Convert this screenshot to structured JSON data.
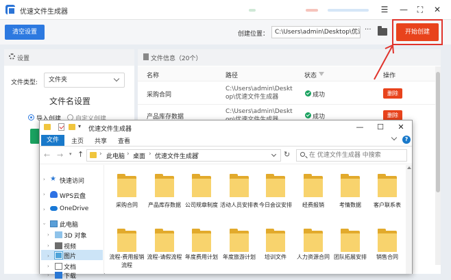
{
  "app": {
    "title": "优速文件生成器",
    "toolbar": {
      "empty_settings": "清空设置",
      "create_location_label": "创建位置：",
      "create_location_value": "C:\\Users\\admin\\Desktop\\优速",
      "more": "···",
      "start_create": "开始创建"
    },
    "window_controls": {
      "menu": "☰",
      "minimize": "—",
      "maximize": "⛶",
      "close": "✕"
    },
    "settings_panel": {
      "header": "设置",
      "file_type_label": "文件类型:",
      "file_type_value": "文件夹",
      "filename_settings_title": "文件名设置",
      "radio_import": "导入创建",
      "radio_custom": "自定义创建"
    },
    "file_info_panel": {
      "header": "文件信息（20个）",
      "columns": {
        "name": "名称",
        "path": "路径",
        "status": "状态",
        "action": "操作"
      },
      "rows": [
        {
          "name": "采购合同",
          "path_line1": "C:\\Users\\admin\\Deskt",
          "path_line2": "op\\优速文件生成器",
          "status": "成功",
          "action": "删除"
        },
        {
          "name": "产品库存数据",
          "path_line1": "C:\\Users\\admin\\Deskt",
          "path_line2": "op\\优速文件生成器",
          "status": "成功",
          "action": "删除"
        }
      ]
    },
    "accent_colors": {
      "primary": "#2d79e0",
      "danger": "#e8431c",
      "success": "#1aa260"
    }
  },
  "explorer": {
    "title": "优速文件生成器",
    "controls": {
      "minimize": "—",
      "maximize": "☐",
      "close": "✕"
    },
    "ribbon_tabs": [
      "文件",
      "主页",
      "共享",
      "查看"
    ],
    "help": "?",
    "address_crumbs": [
      "此电脑",
      "桌面",
      "优速文件生成器"
    ],
    "search_placeholder": "在 优速文件生成器 中搜索",
    "sidebar": [
      {
        "label": "快速访问",
        "icon": "star-icon"
      },
      {
        "label": "WPS云盘",
        "icon": "cloud-icon"
      },
      {
        "label": "OneDrive",
        "icon": "onedrive-icon"
      },
      {
        "label": "此电脑",
        "icon": "computer-icon"
      },
      {
        "label": "3D 对象",
        "icon": "cube-icon"
      },
      {
        "label": "视频",
        "icon": "video-icon"
      },
      {
        "label": "图片",
        "icon": "picture-icon"
      },
      {
        "label": "文档",
        "icon": "document-icon"
      },
      {
        "label": "下载",
        "icon": "download-icon"
      }
    ],
    "folders_row1": [
      "采购合同",
      "产品库存数据",
      "公司规章制度",
      "活动人员安排表",
      "今日会议安排",
      "经费报销",
      "考情数据",
      "客户联系表"
    ],
    "folders_row2": [
      "流程-费用报销流程",
      "流程-请假流程",
      "年度费用计划",
      "年度旅游计划",
      "培训文件",
      "人力资源合同",
      "团队拓展安排",
      "销售合同"
    ]
  }
}
